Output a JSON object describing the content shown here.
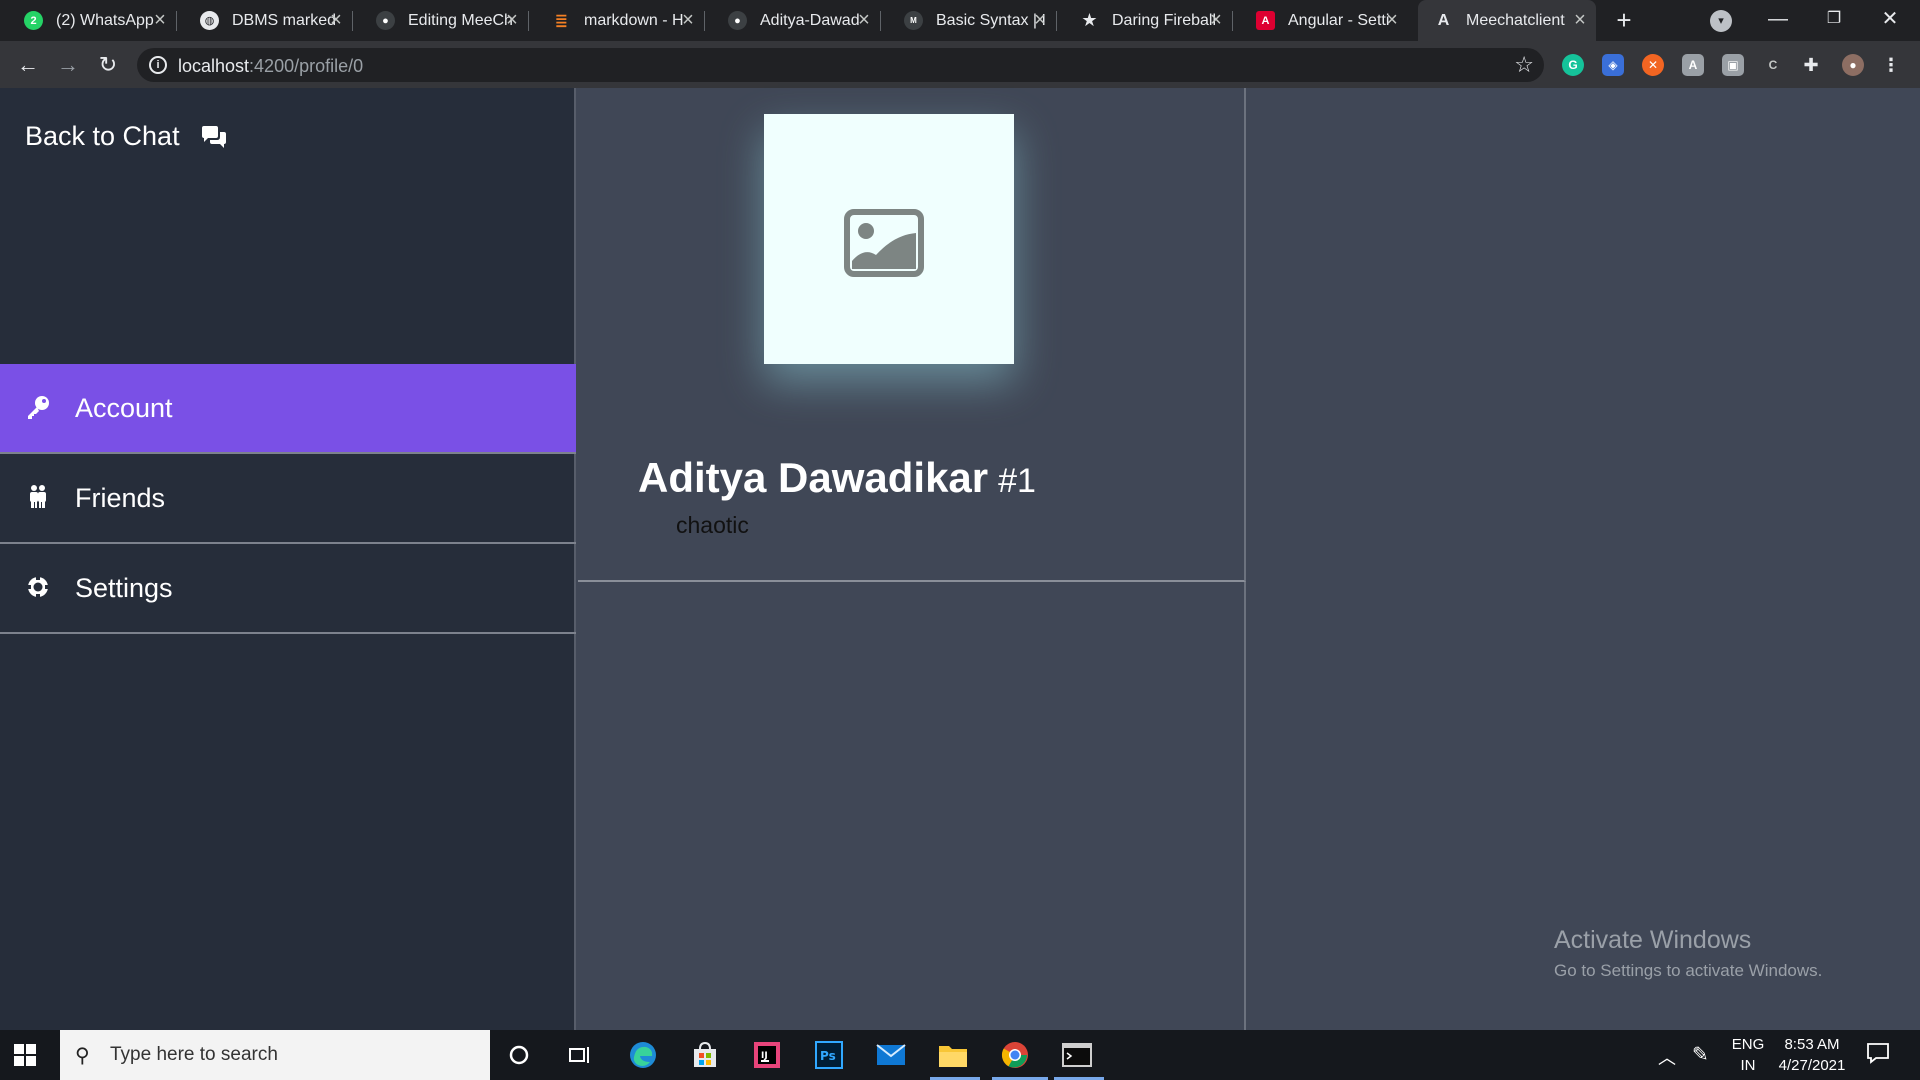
{
  "browser": {
    "tabs": [
      {
        "title": "(2) WhatsApp",
        "icon": "whatsapp-icon",
        "color": "#25d366",
        "badge": "2"
      },
      {
        "title": "DBMS marked",
        "icon": "globe-icon",
        "color": "#e8eaed",
        "badge": ""
      },
      {
        "title": "Editing MeeCh",
        "icon": "github-icon",
        "color": "#3c4043",
        "badge": ""
      },
      {
        "title": "markdown - H",
        "icon": "stackoverflow-icon",
        "color": "#f48024",
        "badge": ""
      },
      {
        "title": "Aditya-Dawad",
        "icon": "github-icon",
        "color": "#3c4043",
        "badge": ""
      },
      {
        "title": "Basic Syntax | I",
        "icon": "markdown-guide-icon",
        "color": "#3c4043",
        "badge": ""
      },
      {
        "title": "Daring Fireball",
        "icon": "star-icon",
        "color": "#e8eaed",
        "badge": "★"
      },
      {
        "title": "Angular - Setti",
        "icon": "angular-icon",
        "color": "#dd0031",
        "badge": "A"
      },
      {
        "title": "Meechatclient",
        "icon": "angular-logo-icon",
        "color": "#e8eaed",
        "badge": "A",
        "active": true
      }
    ],
    "url_host": "localhost",
    "url_path": ":4200/profile/0"
  },
  "app": {
    "back_label": "Back to Chat",
    "menu": [
      {
        "label": "Account",
        "icon": "key-icon",
        "active": true
      },
      {
        "label": "Friends",
        "icon": "friends-icon",
        "active": false
      },
      {
        "label": "Settings",
        "icon": "gear-icon",
        "active": false
      }
    ],
    "profile": {
      "name": "Aditya Dawadikar",
      "id": "#1",
      "status": "chaotic"
    },
    "accent_color": "#7a50e6"
  },
  "watermark": {
    "title": "Activate Windows",
    "subtitle": "Go to Settings to activate Windows."
  },
  "taskbar": {
    "search_placeholder": "Type here to search",
    "lang": "ENG",
    "region": "IN",
    "time": "8:53 AM",
    "date": "4/27/2021"
  }
}
